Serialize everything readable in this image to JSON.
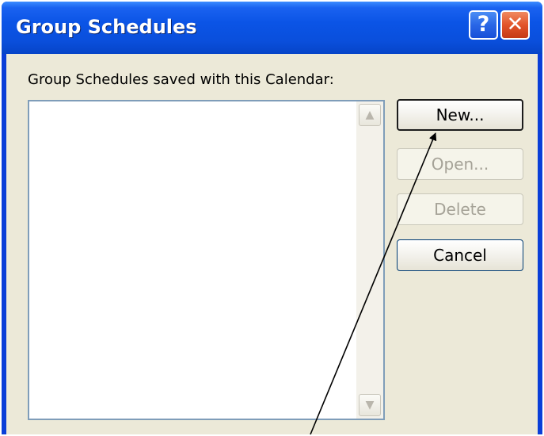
{
  "window": {
    "title": "Group Schedules",
    "help_glyph": "?",
    "close_glyph": "✕"
  },
  "dialog": {
    "caption": "Group Schedules saved with this Calendar:",
    "list_items": []
  },
  "buttons": {
    "new_label": "New...",
    "open_label": "Open...",
    "delete_label": "Delete",
    "cancel_label": "Cancel"
  },
  "colors": {
    "titlebar": "#0a4fdc",
    "client": "#ece9d8",
    "close_button": "#e2542a"
  }
}
